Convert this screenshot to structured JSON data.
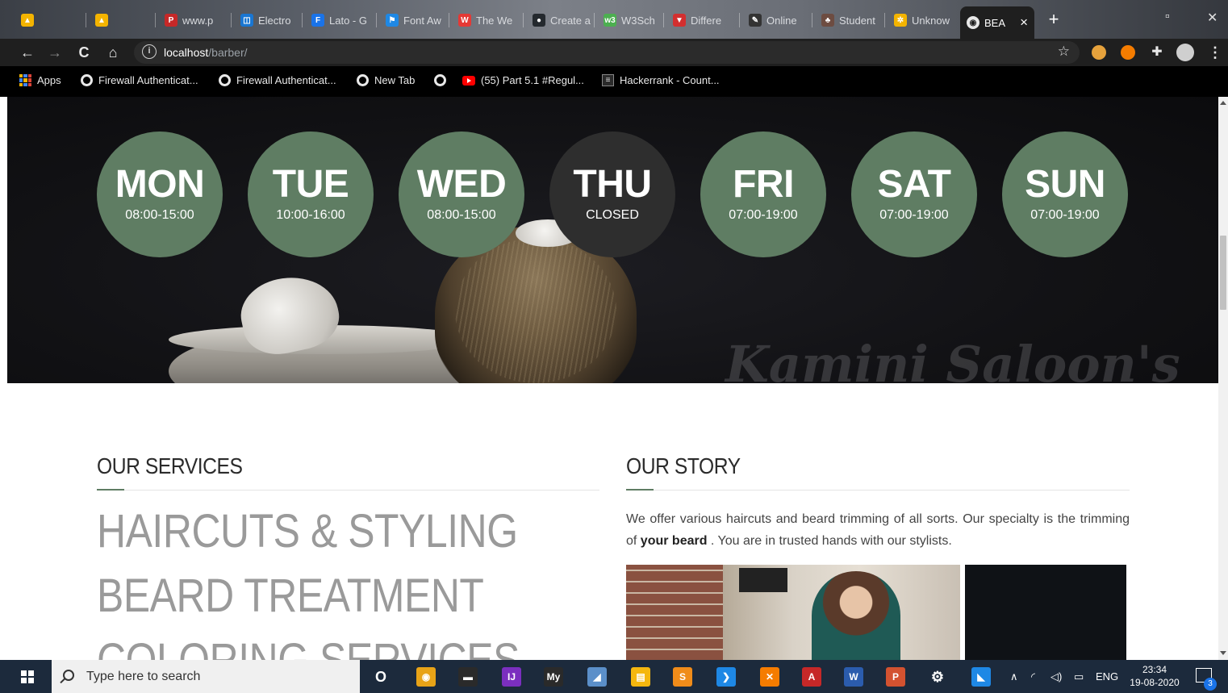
{
  "browser": {
    "tabs": [
      {
        "label": "",
        "fav_color": "#f4b400",
        "fav_glyph": "▲"
      },
      {
        "label": "",
        "fav_color": "#f4b400",
        "fav_glyph": "▲"
      },
      {
        "label": "www.p",
        "fav_color": "#c62828",
        "fav_glyph": "P"
      },
      {
        "label": "Electro",
        "fav_color": "#1976d2",
        "fav_glyph": "◫"
      },
      {
        "label": "Lato - G",
        "fav_color": "#1a73e8",
        "fav_glyph": "F"
      },
      {
        "label": "Font Aw",
        "fav_color": "#1e88e5",
        "fav_glyph": "⚑"
      },
      {
        "label": "The We",
        "fav_color": "#e53935",
        "fav_glyph": "W"
      },
      {
        "label": "Create a",
        "fav_color": "#24292e",
        "fav_glyph": "●"
      },
      {
        "label": "W3Sch",
        "fav_color": "#4caf50",
        "fav_glyph": "w3"
      },
      {
        "label": "Differe",
        "fav_color": "#d32f2f",
        "fav_glyph": "▼"
      },
      {
        "label": "Online",
        "fav_color": "#333333",
        "fav_glyph": "✎"
      },
      {
        "label": "Student",
        "fav_color": "#6d4c41",
        "fav_glyph": "♣"
      },
      {
        "label": "Unknow",
        "fav_color": "#f4b400",
        "fav_glyph": "✲"
      }
    ],
    "active_tab": {
      "label": "BEA",
      "close": "×"
    },
    "new_tab_glyph": "+",
    "url_host": "localhost",
    "url_path": "/barber/",
    "bookmarks": [
      {
        "label": "Apps",
        "icon": "apps-grid-icon"
      },
      {
        "label": "Firewall Authenticat...",
        "icon": "globe-icon"
      },
      {
        "label": "Firewall Authenticat...",
        "icon": "globe-icon"
      },
      {
        "label": "New Tab",
        "icon": "globe-icon"
      },
      {
        "label": "",
        "icon": "globe-icon"
      },
      {
        "label": "(55) Part 5.1 #Regul...",
        "icon": "youtube-icon"
      },
      {
        "label": "Hackerrank - Count...",
        "icon": "hackerrank-icon"
      }
    ]
  },
  "hero": {
    "watermark": "Kamini Saloon's",
    "days": [
      {
        "name": "MON",
        "hours": "08:00-15:00",
        "closed": false
      },
      {
        "name": "TUE",
        "hours": "10:00-16:00",
        "closed": false
      },
      {
        "name": "WED",
        "hours": "08:00-15:00",
        "closed": false
      },
      {
        "name": "THU",
        "hours": "CLOSED",
        "closed": true
      },
      {
        "name": "FRI",
        "hours": "07:00-19:00",
        "closed": false
      },
      {
        "name": "SAT",
        "hours": "07:00-19:00",
        "closed": false
      },
      {
        "name": "SUN",
        "hours": "07:00-19:00",
        "closed": false
      }
    ],
    "accent_color": "#5f7d63",
    "closed_color": "#2e2e2e"
  },
  "services": {
    "title": "OUR SERVICES",
    "items": [
      "HAIRCUTS & STYLING",
      "BEARD TREATMENT",
      "COLORING SERVICES"
    ]
  },
  "story": {
    "title": "OUR STORY",
    "text_before": "We offer various haircuts and beard trimming of all sorts. Our specialty is the trimming of ",
    "text_bold": "your beard",
    "text_after": " . You are in trusted hands with our stylists."
  },
  "taskbar": {
    "search_placeholder": "Type here to search",
    "apps": [
      {
        "name": "cortana-icon",
        "glyph": "O",
        "color": "transparent"
      },
      {
        "name": "chrome-icon",
        "glyph": "◉",
        "color": "#e8a317"
      },
      {
        "name": "terminal-icon",
        "glyph": "▬",
        "color": "#2a2a2a"
      },
      {
        "name": "intellij-icon",
        "glyph": "IJ",
        "color": "#7b2fbf"
      },
      {
        "name": "mysql-icon",
        "glyph": "My",
        "color": "#2a2a2a"
      },
      {
        "name": "notes-icon",
        "glyph": "◢",
        "color": "#5b8fc9"
      },
      {
        "name": "file-explorer-icon",
        "glyph": "▤",
        "color": "#f5b70f"
      },
      {
        "name": "sublime-icon",
        "glyph": "S",
        "color": "#f08c1a"
      },
      {
        "name": "vscode-icon",
        "glyph": "❯",
        "color": "#1e88e5"
      },
      {
        "name": "xampp-icon",
        "glyph": "✕",
        "color": "#f57c00"
      },
      {
        "name": "acrobat-icon",
        "glyph": "A",
        "color": "#c62828"
      },
      {
        "name": "word-icon",
        "glyph": "W",
        "color": "#2b5cad"
      },
      {
        "name": "powerpoint-icon",
        "glyph": "P",
        "color": "#d35230"
      },
      {
        "name": "settings-icon",
        "glyph": "⚙",
        "color": "transparent"
      },
      {
        "name": "photos-icon",
        "glyph": "◣",
        "color": "#1e88e5"
      }
    ],
    "tray_language": "ENG",
    "time": "23:34",
    "date": "19-08-2020",
    "notification_count": "3"
  }
}
